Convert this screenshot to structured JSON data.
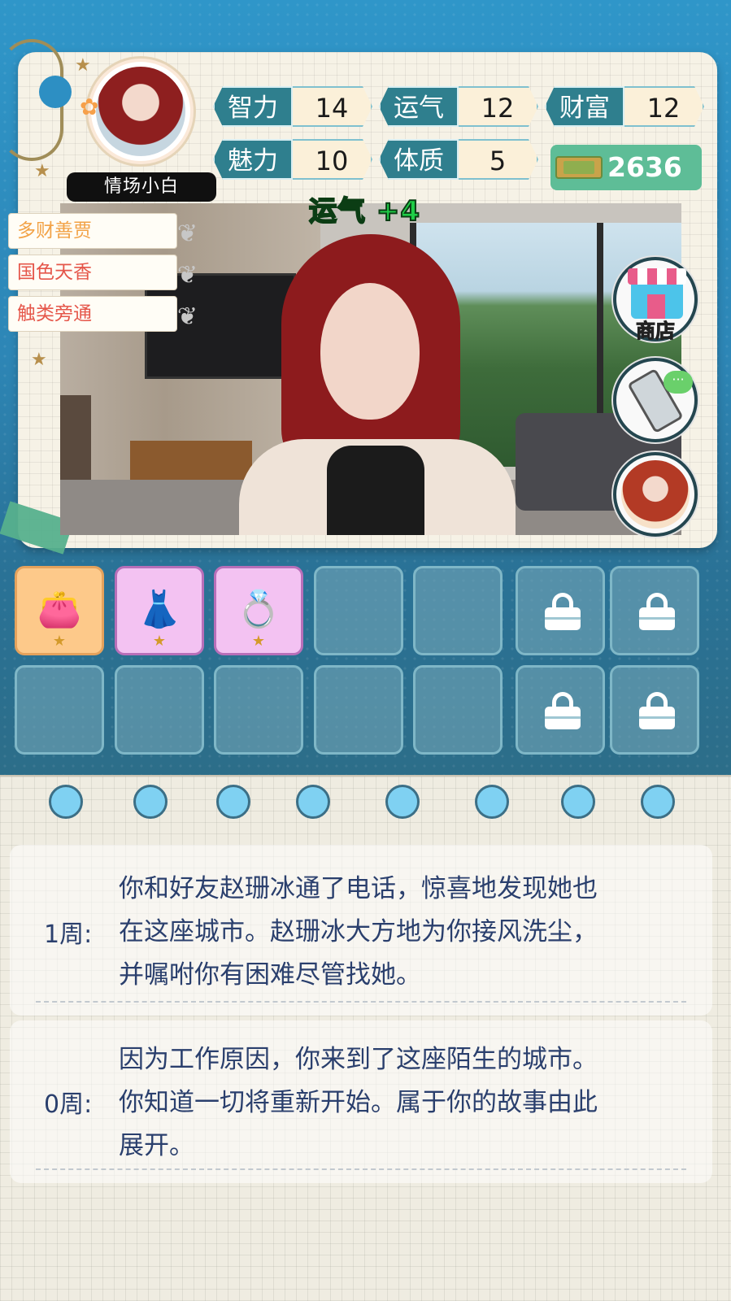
{
  "player": {
    "name": "情场小白"
  },
  "stats": [
    {
      "label": "智力",
      "value": "14"
    },
    {
      "label": "运气",
      "value": "12"
    },
    {
      "label": "财富",
      "value": "12"
    },
    {
      "label": "魅力",
      "value": "10"
    },
    {
      "label": "体质",
      "value": "5"
    }
  ],
  "money": "2636",
  "buff_popup": "运气 +4",
  "traits": [
    "多财善贾",
    "国色天香",
    "触类旁通"
  ],
  "side_buttons": {
    "shop_label": "商店"
  },
  "inventory": {
    "items": [
      {
        "name": "clutch-bag",
        "glyph": "👛",
        "star": "★"
      },
      {
        "name": "white-dress",
        "glyph": "👗",
        "star": "★"
      },
      {
        "name": "gold-ring",
        "glyph": "💍",
        "star": "★"
      }
    ]
  },
  "log": [
    {
      "week": "1周:",
      "lines": [
        "你和好友赵珊冰通了电话，惊喜地发现她也",
        "在这座城市。赵珊冰大方地为你接风洗尘，",
        "并嘱咐你有困难尽管找她。"
      ]
    },
    {
      "week": "0周:",
      "lines": [
        "因为工作原因，你来到了这座陌生的城市。",
        "你知道一切将重新开始。属于你的故事由此",
        "展开。"
      ]
    }
  ],
  "colors": {
    "stat_label_bg": "#2f7f8e",
    "money_bg": "#5ebd97",
    "buff_text": "#1fce47",
    "log_text": "#2a3f6d"
  }
}
